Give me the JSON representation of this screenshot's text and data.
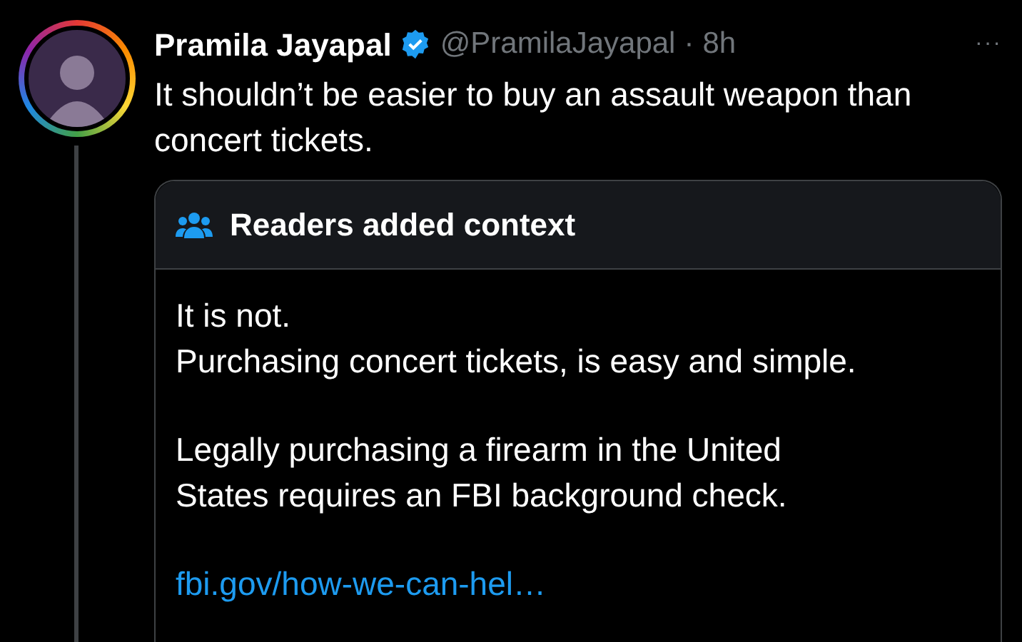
{
  "tweet": {
    "author": "Pramila Jayapal",
    "verified": true,
    "handle": "@PramilaJayapal",
    "separator": "·",
    "time": "8h",
    "menu": "···",
    "text": "It shouldn’t be easier to buy an assault weapon than concert tickets.",
    "context": {
      "title": "Readers added context",
      "paragraphs": [
        [
          "It is not.",
          "Purchasing concert tickets, is easy and simple."
        ],
        [
          "Legally purchasing a firearm in the United",
          "States requires an FBI background check."
        ]
      ],
      "link": "fbi.gov/how-we-can-hel…"
    }
  }
}
